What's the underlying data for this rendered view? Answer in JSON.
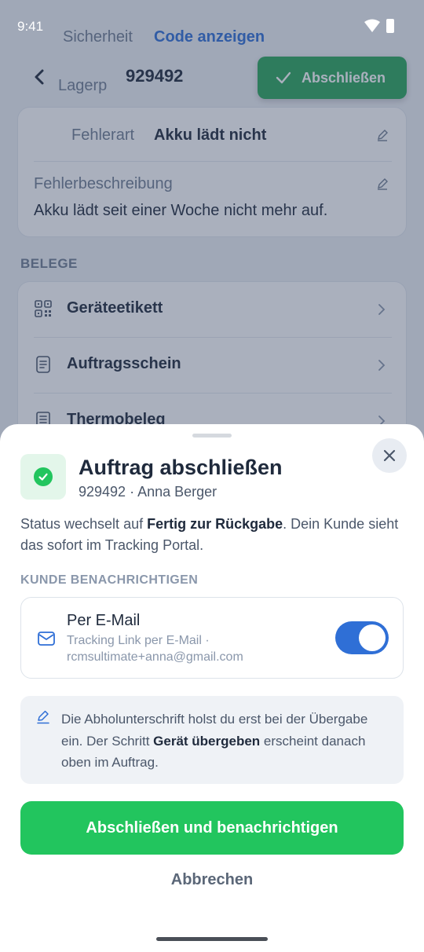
{
  "status_bar": {
    "time": "9:41"
  },
  "header": {
    "order_id": "929492",
    "complete_label": "Abschließen",
    "partial_label": "Lagerp"
  },
  "details": {
    "security_label": "Sicherheit",
    "security_link": "Code anzeigen",
    "error_type_label": "Fehlerart",
    "error_type_value": "Akku lädt nicht",
    "error_desc_label": "Fehlerbeschreibung",
    "error_desc_value": "Akku lädt seit einer Woche nicht mehr auf."
  },
  "documents": {
    "title": "BELEGE",
    "items": [
      {
        "label": "Geräteetikett",
        "icon": "qr-code-icon"
      },
      {
        "label": "Auftragsschein",
        "icon": "document-icon"
      },
      {
        "label": "Thermobeleg",
        "icon": "receipt-icon"
      }
    ]
  },
  "sheet": {
    "title": "Auftrag abschließen",
    "subtitle": "929492 · Anna Berger",
    "desc_pre": "Status wechselt auf ",
    "desc_bold": "Fertig zur Rückgabe",
    "desc_post": ". Dein Kunde sieht das sofort im Tracking Portal.",
    "notify_title": "KUNDE BENACHRICHTIGEN",
    "email": {
      "title": "Per E-Mail",
      "subtitle": "Tracking Link per E-Mail · rcmsultimate+anna@gmail.com",
      "enabled": true
    },
    "info_pre": "Die Abholunterschrift holst du erst bei der Übergabe ein. Der Schritt ",
    "info_bold": "Gerät übergeben",
    "info_post": " erscheint danach oben im Auftrag.",
    "primary_label": "Abschließen und benachrichtigen",
    "cancel_label": "Abbrechen"
  },
  "colors": {
    "accent_blue": "#2f6fd6",
    "success_green": "#22c55e",
    "header_button_green": "#2aa55a"
  }
}
